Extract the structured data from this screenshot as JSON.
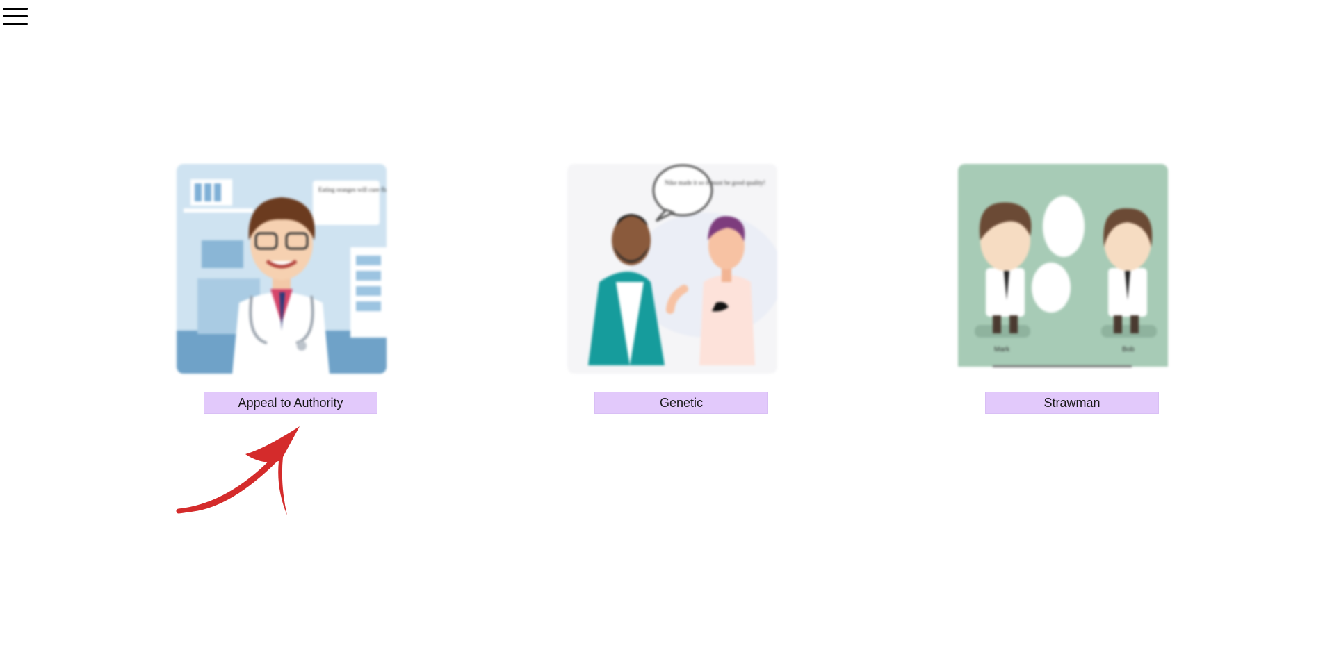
{
  "menu": {
    "icon": "hamburger-menu-icon"
  },
  "cards": [
    {
      "label": "Appeal to Authority",
      "image": "doctor-illustration",
      "bubble": "Eating oranges will cure flu. Trust me, I'm a doctor."
    },
    {
      "label": "Genetic",
      "image": "two-men-discussion-illustration",
      "bubble": "Nike made it so it must be good quality!"
    },
    {
      "label": "Strawman",
      "image": "mark-bob-illustration",
      "names": [
        "Mark",
        "Bob"
      ]
    }
  ],
  "colors": {
    "button_bg": "#e2c9fb",
    "arrow": "#d42b2b"
  },
  "pointer": {
    "icon": "red-arrow-icon"
  }
}
